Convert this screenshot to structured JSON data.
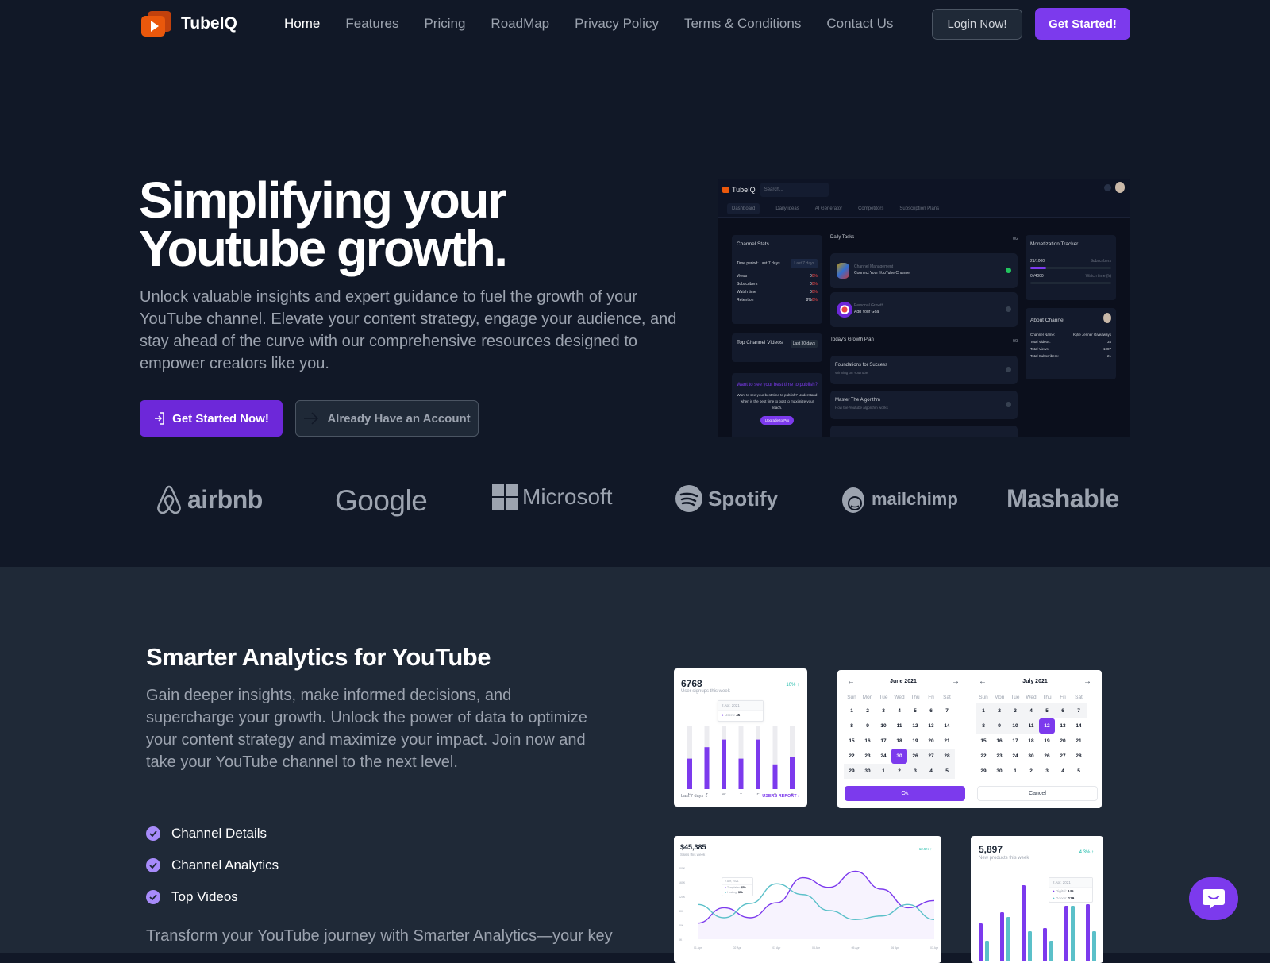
{
  "nav": {
    "brand": "TubeIQ",
    "links": [
      {
        "label": "Home",
        "active": true
      },
      {
        "label": "Features",
        "active": false
      },
      {
        "label": "Pricing",
        "active": false
      },
      {
        "label": "RoadMap",
        "active": false
      },
      {
        "label": "Privacy Policy",
        "active": false
      },
      {
        "label": "Terms & Conditions",
        "active": false
      },
      {
        "label": "Contact Us",
        "active": false
      }
    ],
    "login_label": "Login Now!",
    "start_label": "Get Started!"
  },
  "hero": {
    "title_line1": "Simplifying your",
    "title_line2": "Youtube growth.",
    "description": "Unlock valuable insights and expert guidance to fuel the growth of your YouTube channel. Elevate your content strategy, engage your audience, and stay ahead of the curve with our comprehensive resources designed to empower creators like you.",
    "primary_cta": "Get Started Now!",
    "secondary_cta": "Already Have an Account"
  },
  "preview": {
    "brand": "TubeIQ",
    "search_placeholder": "Search...",
    "tabs": [
      "Dashboard",
      "Daily ideas",
      "AI Generator",
      "Competitors",
      "Subscription Plans"
    ],
    "channel_stats": {
      "title": "Channel Stats",
      "period_label": "Time period: Last 7 days",
      "period_select": "Last 7 days",
      "rows": [
        {
          "label": "Views",
          "value": "0",
          "change": "0%"
        },
        {
          "label": "Subscribers",
          "value": "0",
          "change": "0%"
        },
        {
          "label": "Watch time",
          "value": "0",
          "change": "0%"
        },
        {
          "label": "Retention",
          "value": "8%",
          "change": "0%"
        }
      ]
    },
    "top_videos": {
      "title": "Top Channel Videos",
      "period": "Last 30 days"
    },
    "publish_promo": {
      "title": "Want to see your best time to publish?",
      "text": "Want to see your best time to publish? Understand when is the best time to post to maximize your reach.",
      "button": "Upgrade to Pro"
    },
    "daily_tasks": {
      "title": "Daily Tasks",
      "count": "0/2",
      "items": [
        {
          "category": "Channel Management",
          "title": "Connect Your YouTube Channel",
          "done": true
        },
        {
          "category": "Personal Growth",
          "title": "Add Your Goal",
          "done": false
        }
      ]
    },
    "growth_plan": {
      "title": "Today's Growth Plan",
      "count": "0/3",
      "items": [
        {
          "title": "Foundations for Success",
          "subtitle": "Winning on YouTube"
        },
        {
          "title": "Master The Algorithm",
          "subtitle": "How the Youtube algorithm works"
        }
      ]
    },
    "monetization": {
      "title": "Monetization Tracker",
      "subs_value": "21/1000",
      "subs_label": "Subscribers",
      "subs_progress": 0.021,
      "watch_value": "0 /4000",
      "watch_label": "Watch time (h)",
      "watch_progress": 0
    },
    "about": {
      "title": "About Channel",
      "rows": [
        {
          "label": "Channel Name:",
          "value": "Kylie Jenner Giveaways"
        },
        {
          "label": "Total Videos:",
          "value": "34"
        },
        {
          "label": "Total Views:",
          "value": "1087"
        },
        {
          "label": "Total Subscribers:",
          "value": "21"
        }
      ]
    }
  },
  "logos": [
    "airbnb",
    "Google",
    "Microsoft",
    "Spotify",
    "mailchimp",
    "Mashable"
  ],
  "analytics": {
    "title": "Smarter Analytics for YouTube",
    "description": "Gain deeper insights, make informed decisions, and supercharge your growth. Unlock the power of data to optimize your content strategy and maximize your impact. Join now and take your YouTube channel to the next level.",
    "features": [
      "Channel Details",
      "Channel Analytics",
      "Top Videos"
    ],
    "more_text": "Transform your YouTube journey with Smarter Analytics—your key"
  },
  "widgets": {
    "signups": {
      "value": "6768",
      "subtitle": "User signups this week",
      "change": "10% ↑",
      "tooltip_date": "2 Apr, 2021",
      "tooltip_label": "Users:",
      "tooltip_value": "45",
      "days": [
        "M",
        "T",
        "W",
        "T",
        "F",
        "S",
        "S"
      ],
      "fractions": [
        0.48,
        0.66,
        0.78,
        0.48,
        0.78,
        0.39,
        0.5
      ],
      "footer_left": "Last 7 days",
      "footer_right": "USERS REPORT"
    },
    "calendar": {
      "left_month": "June 2021",
      "right_month": "July 2021",
      "dow": [
        "Sun",
        "Mon",
        "Tue",
        "Wed",
        "Thu",
        "Fri",
        "Sat"
      ],
      "left_days": [
        "1",
        "2",
        "3",
        "4",
        "5",
        "6",
        "7",
        "8",
        "9",
        "10",
        "11",
        "12",
        "13",
        "14",
        "15",
        "16",
        "17",
        "18",
        "19",
        "20",
        "21",
        "22",
        "23",
        "24",
        "30",
        "26",
        "27",
        "28",
        "29",
        "30",
        "1",
        "2",
        "3",
        "4",
        "5"
      ],
      "right_days": [
        "1",
        "2",
        "3",
        "4",
        "5",
        "6",
        "7",
        "8",
        "9",
        "10",
        "11",
        "12",
        "13",
        "14",
        "15",
        "16",
        "17",
        "18",
        "19",
        "20",
        "21",
        "22",
        "23",
        "24",
        "30",
        "26",
        "27",
        "28",
        "29",
        "30",
        "1",
        "2",
        "3",
        "4",
        "5"
      ],
      "left_selected_index": 24,
      "right_selected_index": 11,
      "ok_label": "Ok",
      "cancel_label": "Cancel"
    },
    "sales": {
      "value": "$45,385",
      "subtitle": "Sales this week",
      "change": "12.5% ↑",
      "tooltip_date": "2 Apr, 2021",
      "tooltip_rows": [
        {
          "label": "Templates:",
          "value": "$5k"
        },
        {
          "label": "Hosting:",
          "value": "$7k"
        }
      ]
    },
    "products": {
      "value": "5,897",
      "subtitle": "New products this week",
      "change": "4.3% ↑",
      "tooltip_date": "2 Apr, 2021",
      "tooltip_rows": [
        {
          "label": "Digital:",
          "value": "145"
        },
        {
          "label": "Goods:",
          "value": "179"
        }
      ]
    }
  },
  "chart_data": [
    {
      "type": "bar",
      "title": "User signups this week",
      "categories": [
        "M",
        "T",
        "W",
        "T",
        "F",
        "S",
        "S"
      ],
      "values": [
        48,
        66,
        78,
        48,
        78,
        39,
        50
      ],
      "ylim": [
        0,
        100
      ]
    },
    {
      "type": "line",
      "title": "Sales this week",
      "x": [
        "01 Apr",
        "02 Apr",
        "03 Apr",
        "04 Apr",
        "05 Apr",
        "06 Apr",
        "07 Apr"
      ],
      "yticks": [
        "0K",
        "40K",
        "80K",
        "120K",
        "160K",
        "200K"
      ],
      "ylim": [
        0,
        200
      ],
      "series": [
        {
          "name": "Templates",
          "color": "#7c3aed",
          "values": [
            45,
            88,
            60,
            102,
            172,
            145,
            190,
            140,
            88,
            108
          ]
        },
        {
          "name": "Hosting",
          "color": "#5bc0c9",
          "values": [
            97,
            60,
            100,
            155,
            125,
            80,
            55,
            65,
            97,
            55
          ]
        }
      ]
    },
    {
      "type": "bar",
      "title": "New products this week",
      "series": [
        {
          "name": "Digital",
          "color": "#7c3aed",
          "values": [
            48,
            62,
            96,
            42,
            70,
            72
          ]
        },
        {
          "name": "Goods",
          "color": "#5bc0c9",
          "values": [
            26,
            56,
            38,
            26,
            70,
            38
          ]
        }
      ],
      "ylim": [
        0,
        100
      ]
    }
  ]
}
